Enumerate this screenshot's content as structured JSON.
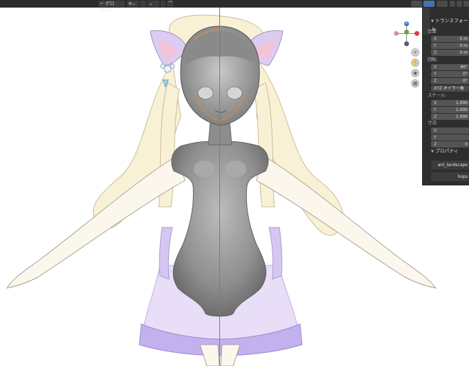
{
  "topbar": {
    "chip1_label": "⌐ グロー..⌄",
    "chip2_label": "⊘⌄",
    "chip3_label": "⌄",
    "chip4_label": "⌒"
  },
  "transform_panel": {
    "title": "トランスフォーム",
    "location_label": "位置:",
    "location": [
      {
        "axis": "X",
        "value": "0 m"
      },
      {
        "axis": "Y",
        "value": "0 m"
      },
      {
        "axis": "Z",
        "value": "0 m"
      }
    ],
    "rotation_label": "回転:",
    "rotation": [
      {
        "axis": "X",
        "value": "90°"
      },
      {
        "axis": "Y",
        "value": "0°"
      },
      {
        "axis": "Z",
        "value": "0°"
      }
    ],
    "rotation_mode": "XYZ オイラー角",
    "scale_label": "スケール:",
    "scale": [
      {
        "axis": "X",
        "value": "1.000"
      },
      {
        "axis": "Y",
        "value": "1.000"
      },
      {
        "axis": "Z",
        "value": "1.000"
      }
    ],
    "dimensions_label": "寸法:",
    "dimensions": [
      {
        "axis": "X",
        "value": ""
      },
      {
        "axis": "Y",
        "value": ""
      },
      {
        "axis": "Z",
        "value": "0"
      }
    ]
  },
  "properties_panel": {
    "title": "プロパティ",
    "items": [
      "ant_landscape",
      "hops"
    ]
  },
  "gizmo": {
    "z_label": "Z",
    "x_color": "#e0394a",
    "y_color": "#6ca535",
    "z_color": "#3a78d6"
  },
  "nav_buttons": [
    "zoom-icon",
    "hand-icon",
    "camera-icon",
    "grid-icon"
  ],
  "colors": {
    "body": "#9a9a9a",
    "skirt": "#c6b4ee",
    "hair": "#f6efcf",
    "ears": "#d9c8f0",
    "panel_bg": "#2e2e2e"
  }
}
